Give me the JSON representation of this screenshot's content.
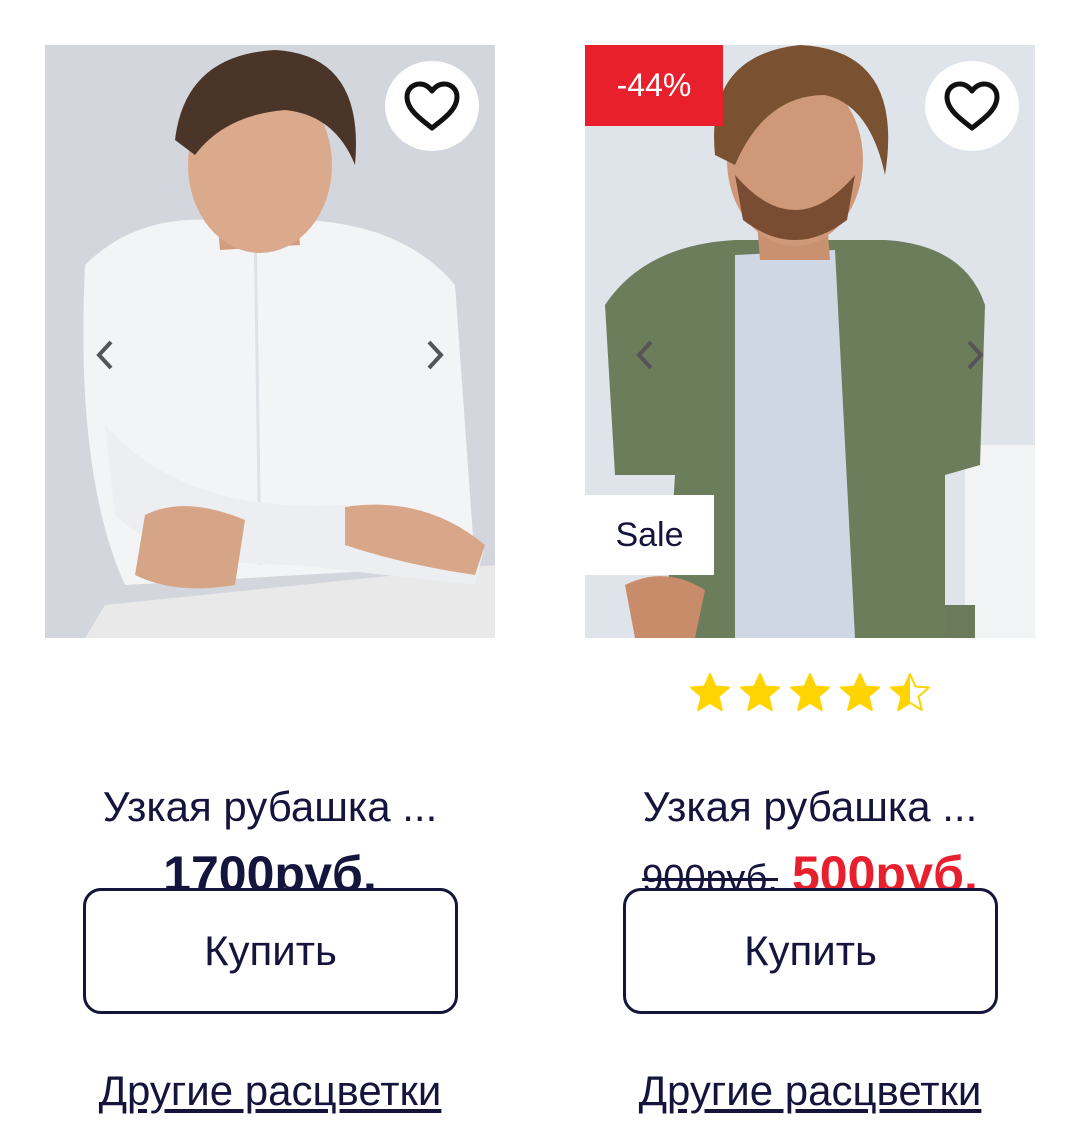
{
  "products": [
    {
      "image_alt": "man in white shirt",
      "favorite_icon": "heart-outline-icon",
      "prev_icon": "chevron-left-icon",
      "next_icon": "chevron-right-icon",
      "name": "Узкая рубашка ...",
      "price": "1700руб.",
      "buy_label": "Купить",
      "colors_link": "Другие расцветки"
    },
    {
      "image_alt": "man in khaki shirt",
      "discount_badge": "-44%",
      "sale_badge": "Sale",
      "favorite_icon": "heart-outline-icon",
      "prev_icon": "chevron-left-icon",
      "next_icon": "chevron-right-icon",
      "rating": 4.5,
      "rating_max": 5,
      "name": "Узкая рубашка ...",
      "old_price": "900руб.",
      "new_price": "500руб.",
      "buy_label": "Купить",
      "colors_link": "Другие расцветки"
    }
  ],
  "colors": {
    "text": "#14143c",
    "accent_red": "#e8202e",
    "star": "#ffd400"
  }
}
